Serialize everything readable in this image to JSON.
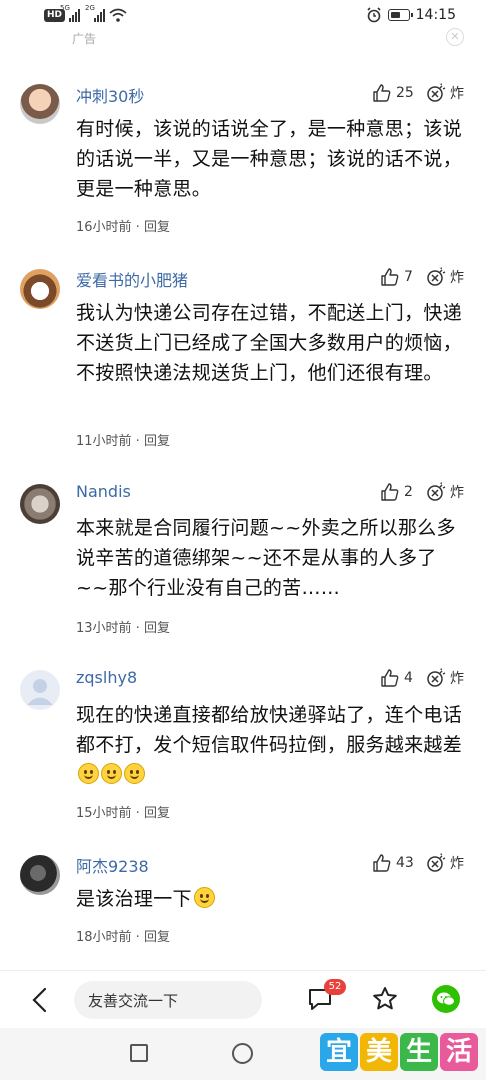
{
  "status_bar": {
    "hd_label": "HD",
    "sig1_label": "5G",
    "sig2_label": "2G",
    "time": "14:15"
  },
  "ad": {
    "label": "广告"
  },
  "comments": [
    {
      "username": "冲刺30秒",
      "likes": "25",
      "boom_label": "炸",
      "text": "有时候，该说的话说全了，是一种意思；该说的话说一半，又是一种意思；该说的话不说，更是一种意思。",
      "time": "16小时前",
      "reply_label": "回复"
    },
    {
      "username": "爱看书的小肥猪",
      "likes": "7",
      "boom_label": "炸",
      "text": "我认为快递公司存在过错，不配送上门，快递不送货上门已经成了全国大多数用户的烦恼，不按照快递法规送货上门，他们还很有理。",
      "time": "11小时前",
      "reply_label": "回复"
    },
    {
      "username": "Nandis",
      "likes": "2",
      "boom_label": "炸",
      "text": "本来就是合同履行问题~~外卖之所以那么多说辛苦的道德绑架~~还不是从事的人多了~~那个行业没有自己的苦……",
      "time": "13小时前",
      "reply_label": "回复"
    },
    {
      "username": "zqslhy8",
      "likes": "4",
      "boom_label": "炸",
      "text": "现在的快递直接都给放快递驿站了，连个电话都不打，发个短信取件码拉倒，服务越来越差",
      "time": "15小时前",
      "reply_label": "回复"
    },
    {
      "username": "阿杰9238",
      "likes": "43",
      "boom_label": "炸",
      "text": "是该治理一下",
      "time": "18小时前",
      "reply_label": "回复"
    }
  ],
  "bottom_bar": {
    "input_placeholder": "友善交流一下",
    "comment_count": "52"
  },
  "watermark": {
    "chars": [
      "宜",
      "美",
      "生",
      "活"
    ],
    "colors": [
      "#2aa7e8",
      "#f2b705",
      "#3cb84a",
      "#e85a9a"
    ]
  },
  "colors": {
    "username": "#3d6aa6",
    "badge": "#e8403a",
    "wechat": "#2dc100"
  }
}
